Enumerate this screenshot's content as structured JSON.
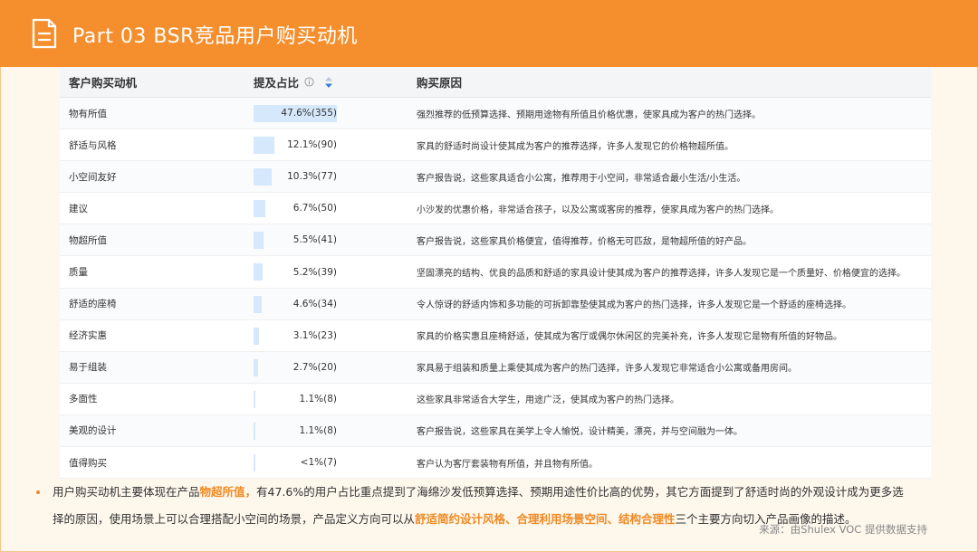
{
  "header": {
    "title": "Part 03  BSR竞品用户购买动机",
    "icon": "document-icon"
  },
  "table": {
    "columns": {
      "motive": "客户购买动机",
      "pct": "提及占比",
      "reason": "购买原因"
    },
    "rows": [
      {
        "motive": "物有所值",
        "pct": "47.6%(355)",
        "share": 47.6,
        "reason": "强烈推荐的低预算选择、预期用途物有所值且价格优惠，使家具成为客户的热门选择。"
      },
      {
        "motive": "舒适与风格",
        "pct": "12.1%(90)",
        "share": 12.1,
        "reason": "家具的舒适时尚设计使其成为客户的推荐选择，许多人发现它的价格物超所值。"
      },
      {
        "motive": "小空间友好",
        "pct": "10.3%(77)",
        "share": 10.3,
        "reason": "客户报告说，这些家具适合小公寓，推荐用于小空间，非常适合最小生活/小生活。"
      },
      {
        "motive": "建议",
        "pct": "6.7%(50)",
        "share": 6.7,
        "reason": "小沙发的优惠价格，非常适合孩子，以及公寓或客房的推荐，使家具成为客户的热门选择。"
      },
      {
        "motive": "物超所值",
        "pct": "5.5%(41)",
        "share": 5.5,
        "reason": "客户报告说，这些家具价格便宜，值得推荐，价格无可匹敌，是物超所值的好产品。"
      },
      {
        "motive": "质量",
        "pct": "5.2%(39)",
        "share": 5.2,
        "reason": "坚固漂亮的结构、优良的品质和舒适的家具设计使其成为客户的推荐选择，许多人发现它是一个质量好、价格便宜的选择。"
      },
      {
        "motive": "舒适的座椅",
        "pct": "4.6%(34)",
        "share": 4.6,
        "reason": "令人惊讶的舒适内饰和多功能的可拆卸靠垫使其成为客户的热门选择，许多人发现它是一个舒适的座椅选择。"
      },
      {
        "motive": "经济实惠",
        "pct": "3.1%(23)",
        "share": 3.1,
        "reason": "家具的价格实惠且座椅舒适，使其成为客厅或偶尔休闲区的完美补充，许多人发现它是物有所值的好物品。"
      },
      {
        "motive": "易于组装",
        "pct": "2.7%(20)",
        "share": 2.7,
        "reason": "家具易于组装和质量上乘使其成为客户的热门选择，许多人发现它非常适合小公寓或备用房间。"
      },
      {
        "motive": "多面性",
        "pct": "1.1%(8)",
        "share": 1.1,
        "reason": "这些家具非常适合大学生，用途广泛，使其成为客户的热门选择。"
      },
      {
        "motive": "美观的设计",
        "pct": "1.1%(8)",
        "share": 1.1,
        "reason": "客户报告说，这些家具在美学上令人愉悦，设计精美，漂亮，并与空间融为一体。"
      },
      {
        "motive": "值得购买",
        "pct": "<1%(7)",
        "share": 0.9,
        "reason": "客户认为客厅套装物有所值，并且物有所值。"
      }
    ]
  },
  "summary": {
    "line1_a": "用户购买动机主要体现在产品",
    "line1_hl": "物超所值，",
    "line1_b": "有47.6%的用户占比重点提到了海绵沙发低预算选择、预期用途性价比高的优势，其它方面提到了舒适时尚的外观设计成为更多选",
    "line2_a": "择的原因，使用场景上可以合理搭配小空间的场景，产品定义方向可以从",
    "line2_hl": "舒适简约设计风格、合理利用场景空间、结构合理性",
    "line2_b": "三个主要方向切入产品画像的描述。"
  },
  "source": "来源：由Shulex VOC 提供数据支持",
  "colors": {
    "header_bg": "#f58f2e",
    "highlight": "#f08a24",
    "bar": "#d6e8fb"
  }
}
